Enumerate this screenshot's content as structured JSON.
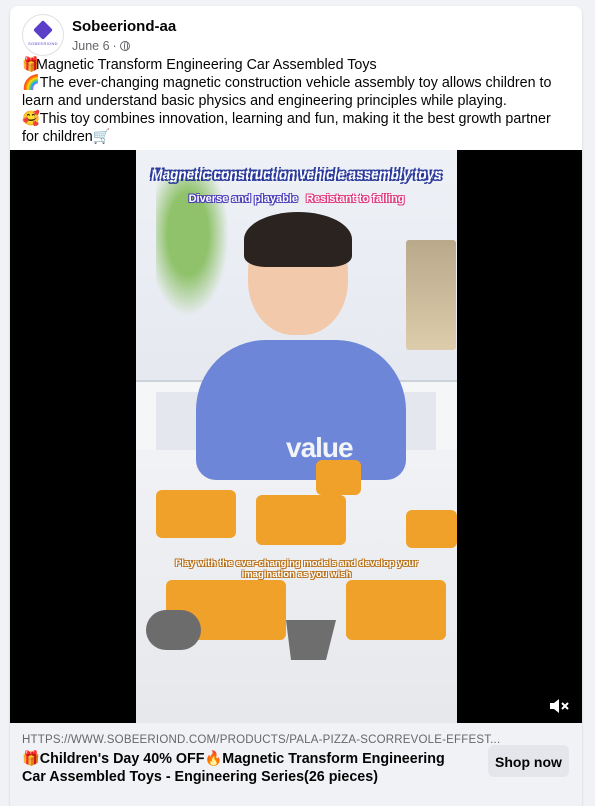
{
  "post": {
    "author": "Sobeeriond-aa",
    "date": "June 6",
    "avatar_text": "SOBEERIOND",
    "lines": [
      {
        "emoji": "🎁",
        "text": "Magnetic Transform Engineering Car Assembled Toys"
      },
      {
        "emoji": "🌈",
        "text": "The ever-changing magnetic construction vehicle assembly toy allows children to learn and understand basic physics and engineering principles while playing."
      },
      {
        "emoji": "🥰",
        "text": "This toy combines innovation, learning and fun, making it the best growth partner for children🛒"
      }
    ]
  },
  "video": {
    "title": "Magnetic construction vehicle assembly toys",
    "tag1": "Diverse and playable",
    "tag2": "Resistant to falling",
    "shirt_text": "value",
    "caption": "Play with the ever-changing models and develop your imagination as you wish"
  },
  "link": {
    "url": "HTTPS://WWW.SOBEERIOND.COM/PRODUCTS/PALA-PIZZA-SCORREVOLE-EFFEST...",
    "title": "🎁Children's Day 40% OFF🔥Magnetic Transform Engineering Car Assembled Toys - Engineering Series(26 pieces)",
    "button_label": "Shop now"
  },
  "colors": {
    "accent": "#5b3fc9",
    "link_bg": "#f0f2f5",
    "button_bg": "#e4e6eb"
  }
}
